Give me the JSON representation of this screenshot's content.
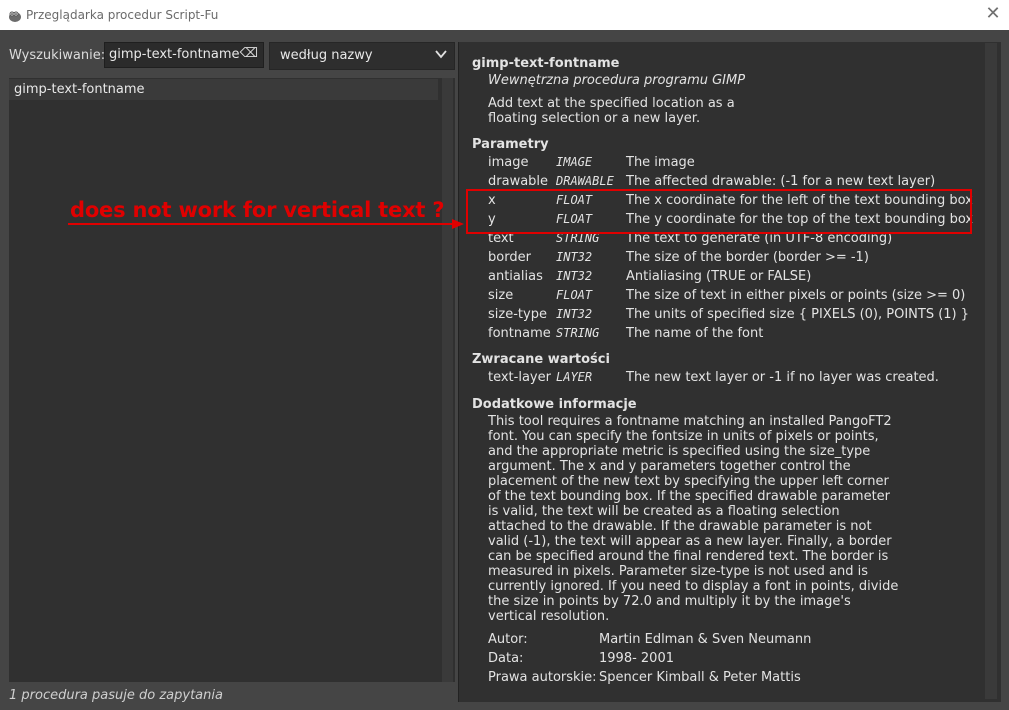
{
  "window": {
    "title": "Przeglądarka procedur Script-Fu"
  },
  "search": {
    "label": "Wyszukiwanie:",
    "value": "gimp-text-fontname",
    "mode": "według nazwy"
  },
  "list": {
    "items": [
      "gimp-text-fontname"
    ]
  },
  "status": "1 procedura pasuje do zapytania",
  "detail": {
    "name": "gimp-text-fontname",
    "origin": "Wewnętrzna procedura programu GIMP",
    "description": "Add text at the specified location as a\nfloating selection or a new layer.",
    "params_heading": "Parametry",
    "params": [
      {
        "name": "image",
        "type": "IMAGE",
        "desc": "The image"
      },
      {
        "name": "drawable",
        "type": "DRAWABLE",
        "desc": "The affected drawable: (-1 for a new text layer)"
      },
      {
        "name": "x",
        "type": "FLOAT",
        "desc": "The x coordinate for the left of the text bounding box"
      },
      {
        "name": "y",
        "type": "FLOAT",
        "desc": "The y coordinate for the top of the text bounding box"
      },
      {
        "name": "text",
        "type": "STRING",
        "desc": "The text to generate (in UTF-8 encoding)"
      },
      {
        "name": "border",
        "type": "INT32",
        "desc": "The size of the border (border >= -1)"
      },
      {
        "name": "antialias",
        "type": "INT32",
        "desc": "Antialiasing (TRUE or FALSE)"
      },
      {
        "name": "size",
        "type": "FLOAT",
        "desc": "The size of text in either pixels or points (size >= 0)"
      },
      {
        "name": "size-type",
        "type": "INT32",
        "desc": "The units of specified size { PIXELS (0), POINTS (1) }"
      },
      {
        "name": "fontname",
        "type": "STRING",
        "desc": "The name of the font"
      }
    ],
    "return_heading": "Zwracane wartości",
    "returns": [
      {
        "name": "text-layer",
        "type": "LAYER",
        "desc": "The new text layer or -1 if no layer was created."
      }
    ],
    "extra_heading": "Dodatkowe informacje",
    "extra_text": "This tool requires a fontname matching an installed PangoFT2\nfont. You can specify the fontsize in units of pixels or points,\nand the appropriate metric is specified using the size_type\nargument. The x and y parameters together control the\nplacement of the new text by specifying the upper left corner\nof the text bounding box. If the specified drawable parameter\nis valid, the text will be created as a floating selection\nattached to the drawable. If the drawable parameter is not\nvalid (-1), the text will appear as a new layer. Finally, a border\ncan be specified around the final rendered text. The border is\nmeasured in pixels. Parameter size-type is not used and is\ncurrently ignored. If you need to display a font in points, divide\nthe size in points by 72.0 and multiply it by the image's\nvertical resolution.",
    "meta": [
      {
        "label": "Autor:",
        "value": "Martin Edlman & Sven Neumann"
      },
      {
        "label": "Data:",
        "value": "1998- 2001"
      },
      {
        "label": "Prawa autorskie:",
        "value": "Spencer Kimball & Peter Mattis"
      }
    ]
  },
  "annotation": {
    "text": "does not work for vertical text ?",
    "color": "#e00000"
  }
}
